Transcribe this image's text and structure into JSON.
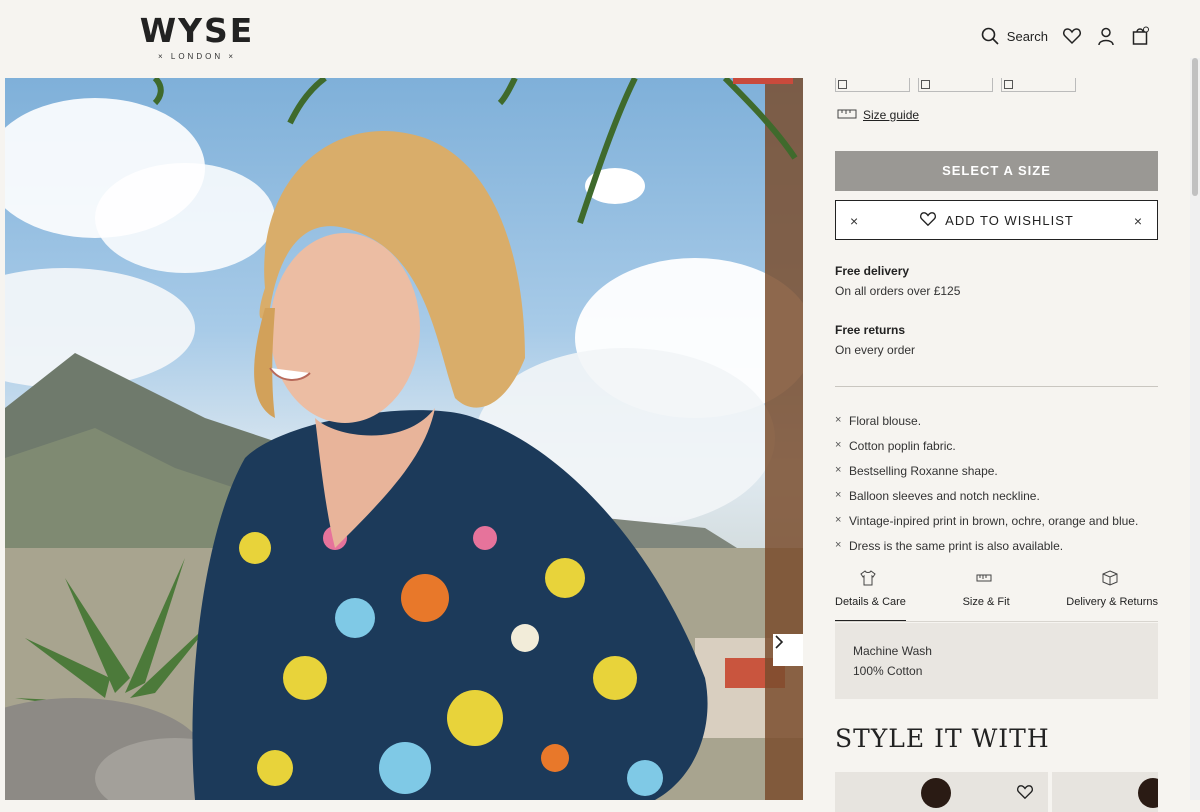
{
  "brand": {
    "name": "WYSE",
    "sub": "× LONDON ×"
  },
  "header": {
    "search_label": "Search"
  },
  "icons": {
    "search": "search-icon",
    "wishlist": "heart-icon",
    "account": "user-icon",
    "bag": "bag-icon",
    "next": "chevron-right-icon"
  },
  "product": {
    "size_guide": "Size guide",
    "select_size": "SELECT A SIZE",
    "add_wishlist": "ADD TO WISHLIST",
    "delivery": {
      "title": "Free delivery",
      "text": "On all orders over £125"
    },
    "returns": {
      "title": "Free returns",
      "text": "On every order"
    },
    "features": [
      "Floral blouse.",
      "Cotton poplin fabric.",
      "Bestselling Roxanne shape.",
      "Balloon sleeves and notch neckline.",
      "Vintage-inpired print in brown, ochre, orange and blue.",
      "Dress is the same print is also available."
    ],
    "tabs": [
      {
        "label": "Details & Care",
        "icon": "shirt-icon",
        "active": true
      },
      {
        "label": "Size & Fit",
        "icon": "ruler-icon",
        "active": false
      },
      {
        "label": "Delivery & Returns",
        "icon": "box-icon",
        "active": false
      }
    ],
    "care": [
      "Machine Wash",
      "100% Cotton"
    ],
    "style_it_with": "STYLE IT WITH"
  },
  "colors": {
    "accent_strip": "#c94a3c",
    "button_disabled": "#9a9894",
    "page_bg": "#f6f4f0"
  }
}
